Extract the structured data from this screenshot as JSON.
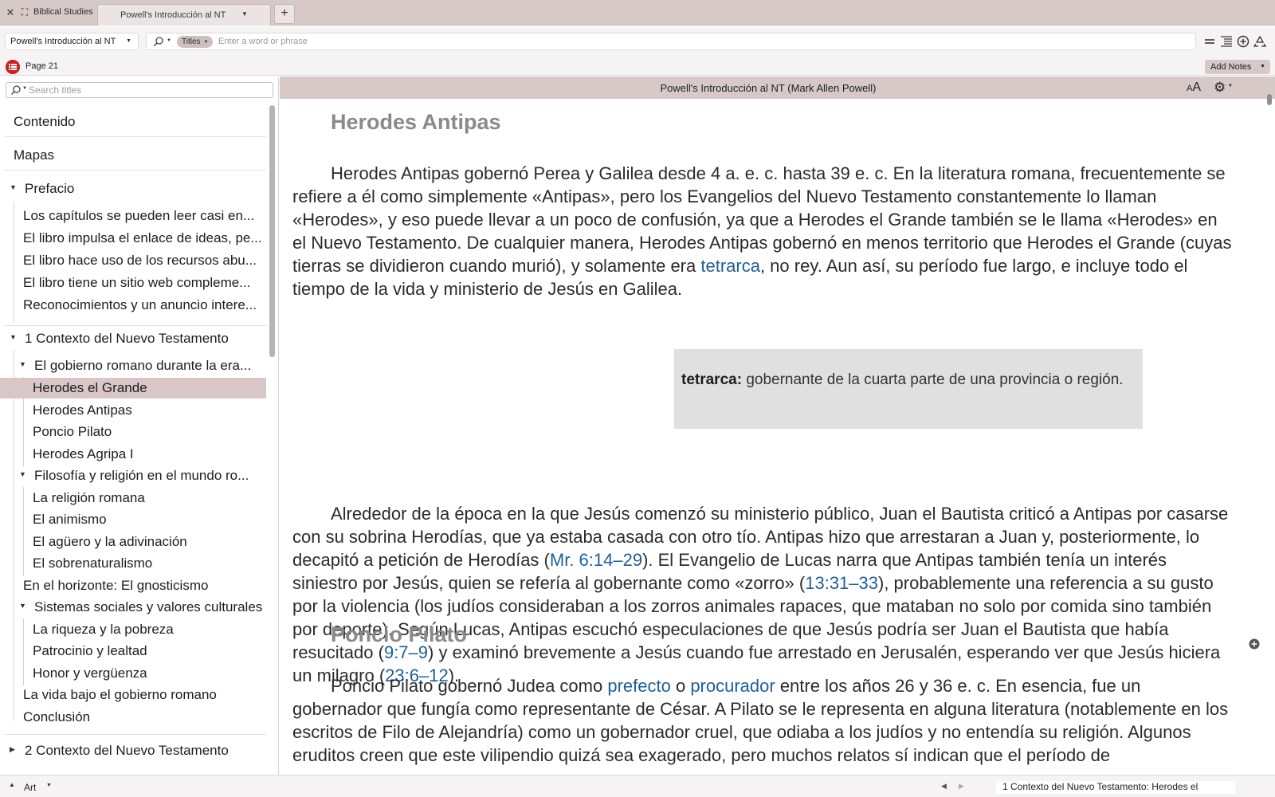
{
  "tabbar": {
    "layout_name": "Biblical Studies",
    "tab_label": "Powell's Introducción al NT",
    "new_tab": "+"
  },
  "toolbar": {
    "resource": "Powell's Introducción al NT",
    "scope": "Titles",
    "search_placeholder": "Enter a word or phrase",
    "search_value": ""
  },
  "pagebar": {
    "page": "Page 21",
    "add_notes": "Add Notes"
  },
  "sidebar": {
    "search_placeholder": "Search titles",
    "items": [
      {
        "label": "Contenido"
      },
      {
        "label": "Mapas"
      },
      {
        "label": "Prefacio"
      },
      {
        "label": "Los capítulos se pueden leer casi en..."
      },
      {
        "label": "El libro impulsa el enlace de ideas, pe..."
      },
      {
        "label": "El libro hace uso de los recursos abu..."
      },
      {
        "label": "El libro tiene un sitio web compleme..."
      },
      {
        "label": "Reconocimientos y un anuncio intere..."
      },
      {
        "label": "1 Contexto del Nuevo Testamento"
      },
      {
        "label": "El gobierno romano durante la era..."
      },
      {
        "label": "Herodes el Grande"
      },
      {
        "label": "Herodes Antipas"
      },
      {
        "label": "Poncio Pilato"
      },
      {
        "label": "Herodes Agripa I"
      },
      {
        "label": "Filosofía y religión en el mundo ro..."
      },
      {
        "label": "La religión romana"
      },
      {
        "label": "El animismo"
      },
      {
        "label": "El agüero y la adivinación"
      },
      {
        "label": "El sobrenaturalismo"
      },
      {
        "label": "En el horizonte: El gnosticismo"
      },
      {
        "label": "Sistemas sociales y valores culturales"
      },
      {
        "label": "La riqueza y la pobreza"
      },
      {
        "label": "Patrocinio y lealtad"
      },
      {
        "label": "Honor y vergüenza"
      },
      {
        "label": "La vida bajo el gobierno romano"
      },
      {
        "label": "Conclusión"
      },
      {
        "label": "2 Contexto del Nuevo Testamento"
      }
    ]
  },
  "reader": {
    "title": "Powell's Introducción al NT (Mark Allen Powell)",
    "font_btn_big": "A",
    "font_btn_small": "A",
    "heading1": "Herodes Antipas",
    "p1": {
      "a": "Herodes Antipas gobernó Perea y Galilea desde 4 a. e. c. hasta 39 e. c. En la literatura romana, frecuentemente se refiere a él como simplemente «Antipas», pero los Evangelios del Nuevo Testamento constantemente lo llaman «Herodes», y eso puede llevar a un poco de confusión, ya que a Herodes el Grande también se le llama «Herodes» en el Nuevo Testamento. De cualquier manera, Herodes Antipas gobernó en menos territorio que Herodes el Grande (cuyas tierras se dividieron cuando murió), y solamente era ",
      "link": "tetrarca",
      "b": ", no rey. Aun así, su período fue largo, e incluye todo el tiempo de la vida y ministerio de Jesús en Galilea."
    },
    "note": {
      "term": "tetrarca:",
      "definition": " gobernante de la cuarta parte de una provincia o región."
    },
    "p2": {
      "a": "Alrededor de la época en la que Jesús comenzó su ministerio público, Juan el Bautista criticó a Antipas por casarse con su sobrina Herodías, que ya estaba casada con otro tío. Antipas hizo que arrestaran a Juan y, posteriormente, lo decapitó a petición de Herodías (",
      "ref1": "Mr. 6:14–29",
      "b": "). El Evangelio de Lucas narra que Antipas también tenía un interés siniestro por Jesús, quien se refería al gobernante como «zorro» (",
      "ref2": "13:31–33",
      "c": "), probablemente una referencia a su gusto por la violencia (los judíos consideraban a los zorros animales rapaces, que mataban no solo por comida sino también por deporte). Según Lucas, Antipas escuchó especulaciones de que Jesús podría ser Juan el Bautista que había resucitado (",
      "ref3": "9:7–9",
      "d": ") y examinó brevemente a Jesús cuando fue arrestado en Jerusalén, esperando ver que Jesús hiciera un milagro (",
      "ref4": "23:6–12",
      "e": ")."
    },
    "heading2": "Poncio Pilato",
    "p3": {
      "a": "Poncio Pilato gobernó Judea como ",
      "link1": "prefecto",
      "b": " o ",
      "link2": "procurador",
      "c": " entre los años 26 y 36 e. c. En esencia, fue un gobernador que fungía como representante de César. A Pilato se le representa en alguna literatura (notablemente en los escritos de Filo de Alejandría) como un gobernador cruel, que odiaba a los judíos y no entendía su religión. Algunos eruditos creen que este vilipendio quizá sea exagerado, pero muchos relatos sí indican que el período de"
    }
  },
  "statusbar": {
    "art": "Art",
    "breadcrumb": "1 Contexto del Nuevo Testamento: Herodes el"
  },
  "colors": {
    "chrome": "#d8c9c9",
    "link": "#1e5f99",
    "heading": "#8a8a8a",
    "selected_row": "#d9c7c7",
    "toc_button": "#c9221f"
  },
  "icons": [
    "close-icon",
    "fullscreen-icon",
    "search-icon",
    "list-icon",
    "outline-icon",
    "add-circle-icon",
    "recycle-icon",
    "toc-icon",
    "gear-icon",
    "font-size-icon"
  ]
}
